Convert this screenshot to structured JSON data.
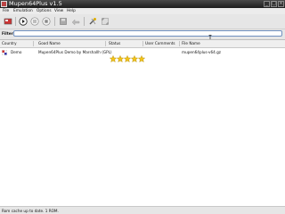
{
  "window": {
    "title": "Mupen64Plus  v1.5"
  },
  "menu": {
    "items": [
      {
        "label": "File"
      },
      {
        "label": "Emulation"
      },
      {
        "label": "Options"
      },
      {
        "label": "View"
      },
      {
        "label": "Help"
      }
    ]
  },
  "toolbar": {
    "icons": [
      "open-rom-icon",
      "play-icon",
      "pause-icon",
      "stop-icon",
      "save-state-icon",
      "load-state-icon",
      "configure-icon",
      "fullscreen-icon"
    ]
  },
  "filter": {
    "label": "Filter:",
    "value": ""
  },
  "table": {
    "columns": [
      "Country",
      "Good Name",
      "Status",
      "User Comments",
      "File Name"
    ],
    "rows": [
      {
        "country": "Demo",
        "good_name": "Mupen64Plus Demo by Marshallh (GPL)",
        "status_stars": 5,
        "user_comments": "",
        "file_name": "mupen64plus-v64.gz"
      }
    ]
  },
  "statusbar": {
    "text": "Rom cache up to date. 1 ROM."
  },
  "colors": {
    "star": "#f2c21a",
    "filter_border": "#6f8fbf"
  }
}
